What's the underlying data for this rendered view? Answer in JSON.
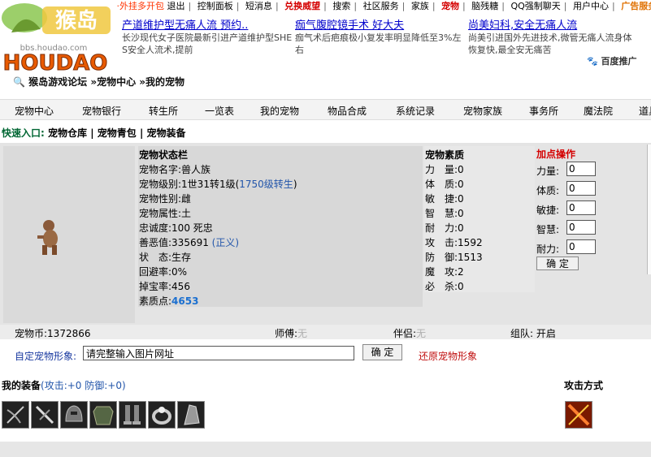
{
  "topbar": {
    "items": [
      "·外挂多开包",
      "退出",
      "控制面板",
      "短消息",
      "兑换威望",
      "搜索",
      "社区服务",
      "家族",
      "宠物",
      "脑残糖",
      "QQ强制聊天",
      "用户中心",
      "广告服务"
    ]
  },
  "logo": {
    "text": "HOUDAO",
    "sub": "bbs.houdao.com",
    "cn": "猴岛"
  },
  "ads": [
    {
      "title": "产道维护型无痛人流 预约..",
      "desc": "长沙现代女子医院最新引进产道维护型SHE S安全人流术,提前"
    },
    {
      "title": "痂气腹腔镜手术 好大夫",
      "desc": "痂气术后疤痕极小复发率明显降低至3%左右"
    },
    {
      "title": "尚美妇科,安全无痛人流",
      "desc": "尚美引进国外先进技术,微管无痛人流身体恢复快,最全安无痛苦"
    }
  ],
  "baidu": "百度推广",
  "breadcrumb": "猴岛游戏论坛 »宠物中心 »我的宠物",
  "nav": [
    "宠物中心",
    "宠物银行",
    "转生所",
    "一览表",
    "我的宠物",
    "物品合成",
    "系统记录",
    "宠物家族",
    "事务所",
    "魔法院",
    "道具"
  ],
  "quick": {
    "label": "快速入口:",
    "links": [
      "宠物仓库",
      "宠物青包",
      "宠物装备"
    ]
  },
  "stats": {
    "title": "宠物状态栏",
    "name": "宠物名字:兽人族",
    "level_prefix": "宠物级别:1世31转1级(",
    "level_link": "1750级转生",
    "level_suffix": ")",
    "gender": "宠物性别:雌",
    "attr": "宠物属性:土",
    "loyalty": "忠诚度:100 死忠",
    "morality_prefix": "善恶值:335691 ",
    "morality_link": "(正义)",
    "state": "状　态:生存",
    "dodge": "回避率:0%",
    "drop": "掉宝率:456",
    "quality_label": "素质点:",
    "quality_value": "4653"
  },
  "quality": {
    "title": "宠物素质",
    "rows": [
      "力　量:0",
      "体　质:0",
      "敏　捷:0",
      "智　慧:0",
      "耐　力:0",
      "攻　击:1592",
      "防　御:1513",
      "魔　攻:2",
      "必　杀:0"
    ]
  },
  "addpts": {
    "title": "加点操作",
    "fields": [
      {
        "label": "力量:",
        "value": "0"
      },
      {
        "label": "体质:",
        "value": "0"
      },
      {
        "label": "敏捷:",
        "value": "0"
      },
      {
        "label": "智慧:",
        "value": "0"
      },
      {
        "label": "耐力:",
        "value": "0"
      }
    ],
    "confirm": "确 定"
  },
  "strip": {
    "coins": "宠物币:1372866",
    "master_label": "师傅:",
    "master": "无",
    "partner_label": "伴侣:",
    "partner": "无",
    "team": "组队: 开启"
  },
  "image": {
    "label": "自定宠物形象:",
    "placeholder": "请完整输入图片网址",
    "confirm": "确 定",
    "restore": "还原宠物形象"
  },
  "equip": {
    "label": "我的装备",
    "stats": "(攻击:+0 防御:+0)",
    "attack_label": "攻击方式"
  },
  "colors": {
    "accent_red": "#d40000",
    "link_blue": "#2255aa",
    "panel": "#e4e4e4"
  }
}
